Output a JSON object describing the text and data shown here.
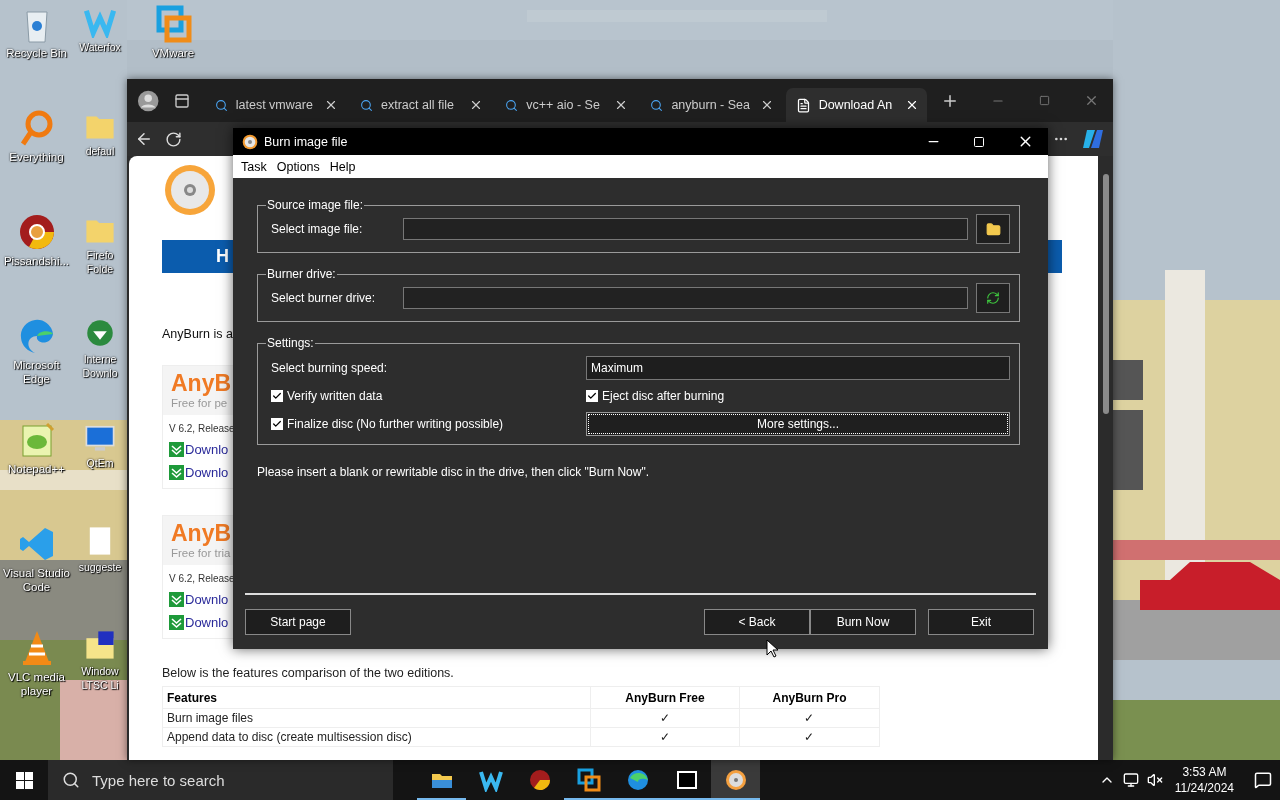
{
  "desktop_icons": [
    {
      "label": "Recycle Bin"
    },
    {
      "label": "Everything"
    },
    {
      "label": "Pissandshi..."
    },
    {
      "label": "Microsoft Edge"
    },
    {
      "label": "Notepad++"
    },
    {
      "label": "Visual Studio Code"
    },
    {
      "label": "VLC media player"
    },
    {
      "label": "Waterfox"
    },
    {
      "label": "defaul"
    },
    {
      "label": "Firefo Folde"
    },
    {
      "label": "Interne Downlo"
    },
    {
      "label": "QtEm"
    },
    {
      "label": "suggeste"
    },
    {
      "label": "Window LTSC Li"
    },
    {
      "label": "VMware"
    }
  ],
  "browser": {
    "tabs": [
      {
        "title": "latest vmware",
        "kind": "search",
        "selected": false
      },
      {
        "title": "extract all file",
        "kind": "search",
        "selected": false
      },
      {
        "title": "vc++ aio - Se",
        "kind": "search",
        "selected": false
      },
      {
        "title": "anyburn - Sea",
        "kind": "search",
        "selected": false
      },
      {
        "title": "Download An",
        "kind": "page",
        "selected": true
      }
    ],
    "page": {
      "banner": "H",
      "intro": "AnyBurn is a",
      "editions": [
        {
          "name": "AnyB",
          "note": "Free for pe",
          "version": "V 6.2, Release",
          "downloads": [
            "Downlo",
            "Downlo"
          ]
        },
        {
          "name": "AnyB",
          "note": "Free for tria",
          "version": "V 6.2, Release",
          "downloads": [
            "Downlo",
            "Downlo"
          ]
        }
      ],
      "comparison_intro": "Below is the features comparison of the two editions.",
      "table": {
        "columns": [
          "Features",
          "AnyBurn Free",
          "AnyBurn Pro"
        ],
        "rows": [
          [
            "Burn image files",
            "✓",
            "✓"
          ],
          [
            "Append data to disc (create multisession disc)",
            "✓",
            "✓"
          ]
        ]
      }
    }
  },
  "dialog": {
    "title": "Burn image file",
    "menu": [
      "Task",
      "Options",
      "Help"
    ],
    "source": {
      "legend": "Source image file:",
      "label": "Select image file:"
    },
    "burner": {
      "legend": "Burner drive:",
      "label": "Select burner drive:"
    },
    "settings": {
      "legend": "Settings:",
      "speed_label": "Select burning speed:",
      "speed": "Maximum",
      "options": [
        {
          "label": "Verify written data",
          "checked": true
        },
        {
          "label": "Eject disc after burning",
          "checked": true
        },
        {
          "label": "Finalize disc (No further writing possible)",
          "checked": true
        }
      ],
      "more_button": "More settings..."
    },
    "message": "Please insert a blank or rewritable disc in the drive, then click \"Burn Now\".",
    "left_buttons": [
      "Start page"
    ],
    "right_buttons": [
      "< Back",
      "Burn Now"
    ],
    "exit_button": "Exit"
  },
  "taskbar": {
    "search_placeholder": "Type here to search",
    "apps": [
      {
        "running": true,
        "selected": false
      },
      {
        "running": false,
        "selected": false
      },
      {
        "running": false,
        "selected": false
      },
      {
        "running": true,
        "selected": false
      },
      {
        "running": true,
        "selected": false
      },
      {
        "running": true,
        "selected": false
      },
      {
        "running": true,
        "selected": true
      }
    ],
    "clock": {
      "time": "3:53 AM",
      "date": "11/24/2024"
    }
  }
}
